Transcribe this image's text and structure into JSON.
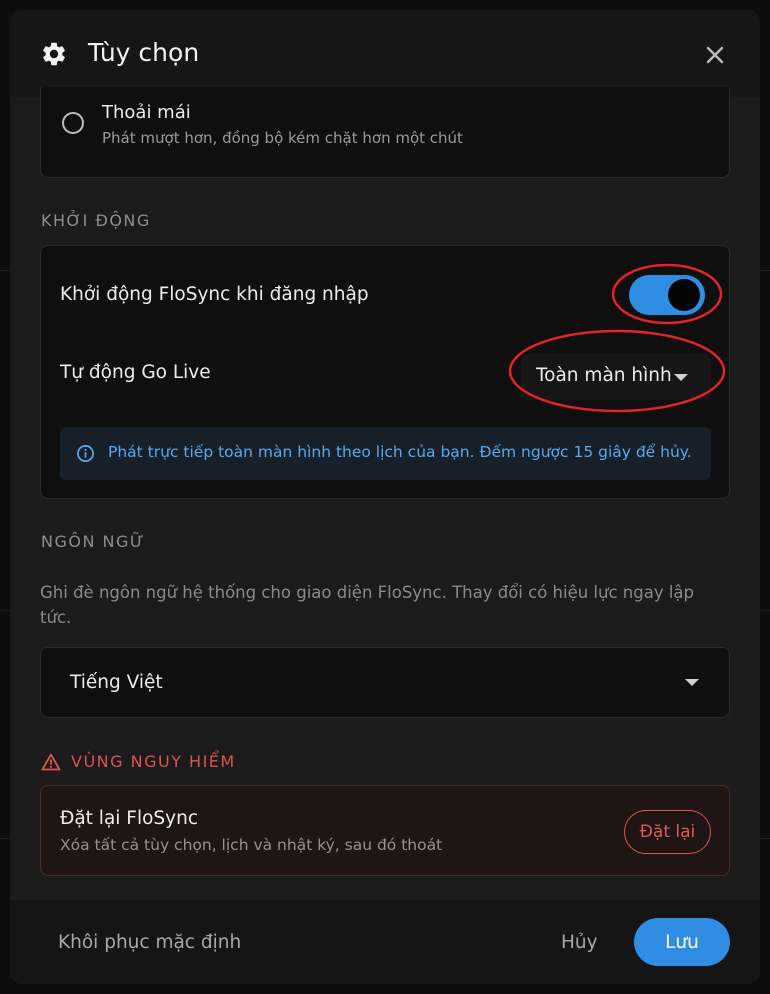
{
  "header": {
    "title": "Tùy chọn",
    "icon": "gear-icon",
    "close_icon": "close-icon"
  },
  "playback_option": {
    "title": "Thoải mái",
    "description": "Phát mượt hơn, đồng bộ kém chặt hơn một chút",
    "selected": false
  },
  "startup": {
    "section_label": "KHỞI ĐỘNG",
    "launch_on_login_label": "Khởi động FloSync khi đăng nhập",
    "launch_on_login_enabled": true,
    "auto_go_live_label": "Tự động Go Live",
    "auto_go_live_value": "Toàn màn hình",
    "info_text": "Phát trực tiếp toàn màn hình theo lịch của bạn. Đếm ngược 15 giây để hủy."
  },
  "language": {
    "section_label": "NGÔN NGỮ",
    "description": "Ghi đè ngôn ngữ hệ thống cho giao diện FloSync. Thay đổi có hiệu lực ngay lập tức.",
    "value": "Tiếng Việt"
  },
  "danger_zone": {
    "section_label": "VÙNG NGUY HIỂM",
    "reset_title": "Đặt lại FloSync",
    "reset_description": "Xóa tất cả tùy chọn, lịch và nhật ký, sau đó thoát",
    "reset_button": "Đặt lại"
  },
  "footer": {
    "restore_defaults": "Khôi phục mặc định",
    "cancel": "Hủy",
    "save": "Lưu"
  },
  "colors": {
    "accent": "#2f8de4",
    "danger": "#e05252",
    "annotation": "#e0242a"
  }
}
